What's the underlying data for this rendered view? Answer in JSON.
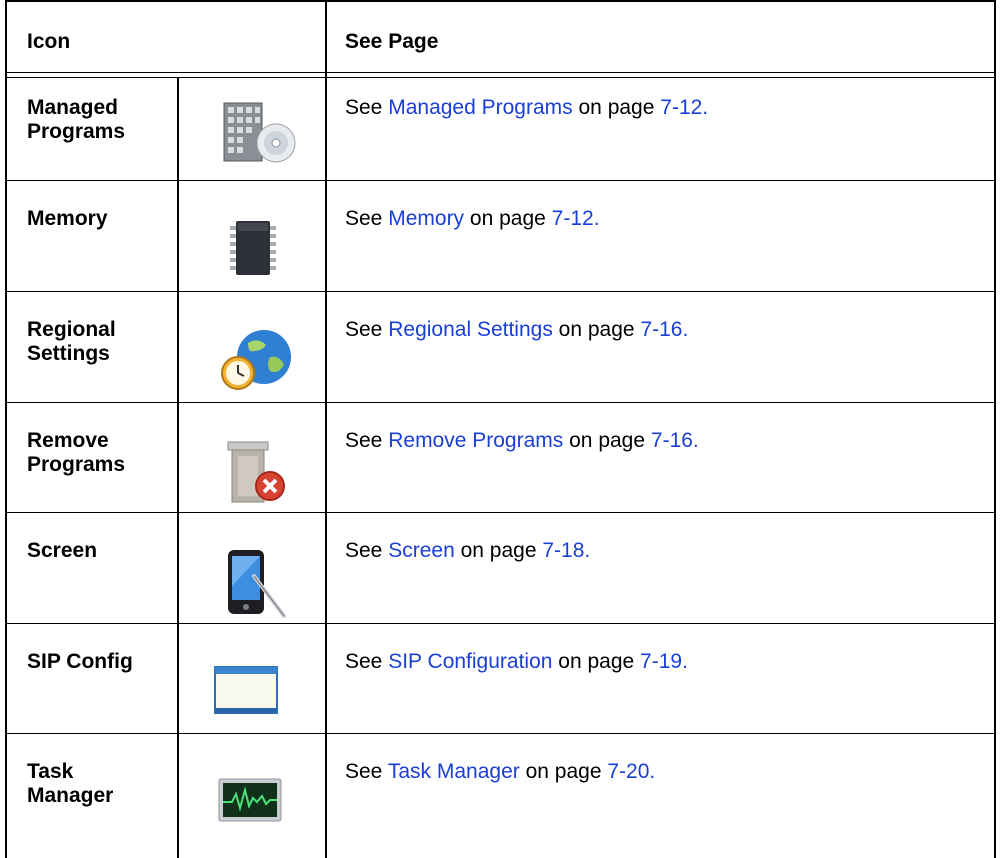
{
  "table": {
    "header": {
      "col1": "Icon",
      "col2": "See Page"
    },
    "rows": [
      {
        "name_line1": "Managed",
        "name_line2": "Programs",
        "icon": "building-cd-icon",
        "see": "See",
        "link_text": "Managed Programs",
        "on_page": "on page",
        "page": "7-12."
      },
      {
        "name_line1": "Memory",
        "name_line2": "",
        "icon": "memory-chip-icon",
        "see": "See",
        "link_text": "Memory",
        "on_page": "on page",
        "page": "7-12."
      },
      {
        "name_line1": "Regional",
        "name_line2": "Settings",
        "icon": "globe-clock-icon",
        "see": "See",
        "link_text": "Regional Settings",
        "on_page": "on page",
        "page": "7-16."
      },
      {
        "name_line1": "Remove",
        "name_line2": "Programs",
        "icon": "remove-programs-icon",
        "see": "See",
        "link_text": "Remove Programs",
        "on_page": "on page",
        "page": "7-16."
      },
      {
        "name_line1": "Screen",
        "name_line2": "",
        "icon": "pda-stylus-icon",
        "see": "See",
        "link_text": "Screen",
        "on_page": "on page",
        "page": "7-18."
      },
      {
        "name_line1": "SIP Config",
        "name_line2": "",
        "icon": "window-icon",
        "see": "See",
        "link_text": "SIP Configuration",
        "on_page": "on page",
        "page": "7-19."
      },
      {
        "name_line1": "Task",
        "name_line2": "Manager",
        "icon": "task-manager-monitor-icon",
        "see": "See",
        "link_text": "Task Manager",
        "on_page": "on page",
        "page": "7-20."
      }
    ]
  },
  "colors": {
    "link": "#1a3fd6",
    "border": "#000000"
  }
}
